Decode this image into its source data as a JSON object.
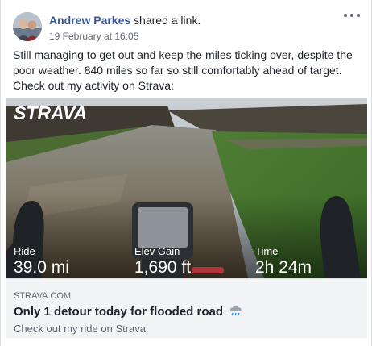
{
  "post": {
    "author": "Andrew Parkes",
    "action": " shared a link.",
    "date": "19 February at 16:05",
    "text": "Still managing to get out and keep the miles ticking over, despite the poor weather. 840 miles so far so still comfortably ahead of target. Check out my activity on Strava:"
  },
  "media": {
    "logo": "STRAVA",
    "stats": [
      {
        "label": "Ride",
        "value": "39.0 mi"
      },
      {
        "label": "Elev Gain",
        "value": "1,690 ft"
      },
      {
        "label": "Time",
        "value": "2h 24m"
      }
    ]
  },
  "link": {
    "domain": "STRAVA.COM",
    "title": "Only 1 detour today for flooded road",
    "title_icon": "rain-cloud-icon",
    "description": "Check out my ride on Strava."
  },
  "icons": {
    "more": "more-options-icon"
  },
  "colors": {
    "author": "#385898",
    "muted": "#606770",
    "link_box": "#f2f3f5"
  }
}
